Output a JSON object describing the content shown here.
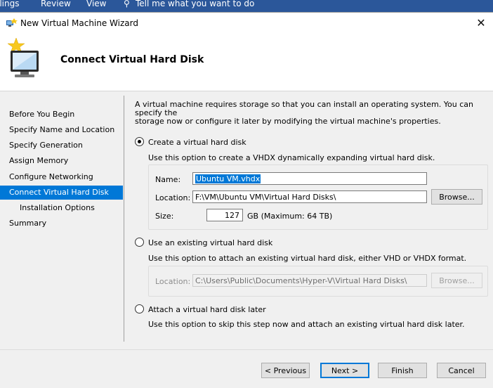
{
  "ribbon": {
    "items": [
      "ilings",
      "Review",
      "View",
      "Tell me what you want to do"
    ]
  },
  "window": {
    "title": "New Virtual Machine Wizard",
    "close_glyph": "✕"
  },
  "header": {
    "title": "Connect Virtual Hard Disk"
  },
  "nav": {
    "items": [
      {
        "label": "Before You Begin"
      },
      {
        "label": "Specify Name and Location"
      },
      {
        "label": "Specify Generation"
      },
      {
        "label": "Assign Memory"
      },
      {
        "label": "Configure Networking"
      },
      {
        "label": "Connect Virtual Hard Disk",
        "active": true
      },
      {
        "label": "Installation Options",
        "sub": true
      },
      {
        "label": "Summary"
      }
    ]
  },
  "content": {
    "intro_line1": "A virtual machine requires storage so that you can install an operating system. You can specify the",
    "intro_line2": "storage now or configure it later by modifying the virtual machine's properties.",
    "create": {
      "label": "Create a virtual hard disk",
      "checked": true,
      "description": "Use this option to create a VHDX dynamically expanding virtual hard disk.",
      "name_label": "Name:",
      "name_value": "Ubuntu VM.vhdx",
      "location_label": "Location:",
      "location_value": "F:\\VM\\Ubuntu VM\\Virtual Hard Disks\\",
      "browse_label": "Browse...",
      "size_label": "Size:",
      "size_value": "127",
      "size_unit": "GB (Maximum: 64 TB)"
    },
    "existing": {
      "label": "Use an existing virtual hard disk",
      "checked": false,
      "description": "Use this option to attach an existing virtual hard disk, either VHD or VHDX format.",
      "location_label": "Location:",
      "location_value": "C:\\Users\\Public\\Documents\\Hyper-V\\Virtual Hard Disks\\",
      "browse_label": "Browse..."
    },
    "later": {
      "label": "Attach a virtual hard disk later",
      "checked": false,
      "description": "Use this option to skip this step now and attach an existing virtual hard disk later."
    }
  },
  "footer": {
    "previous_label": "< Previous",
    "next_label": "Next >",
    "finish_label": "Finish",
    "cancel_label": "Cancel"
  },
  "colors": {
    "accent": "#0078d7",
    "ribbon": "#2b579a",
    "panel_bg": "#f0f0f0"
  }
}
